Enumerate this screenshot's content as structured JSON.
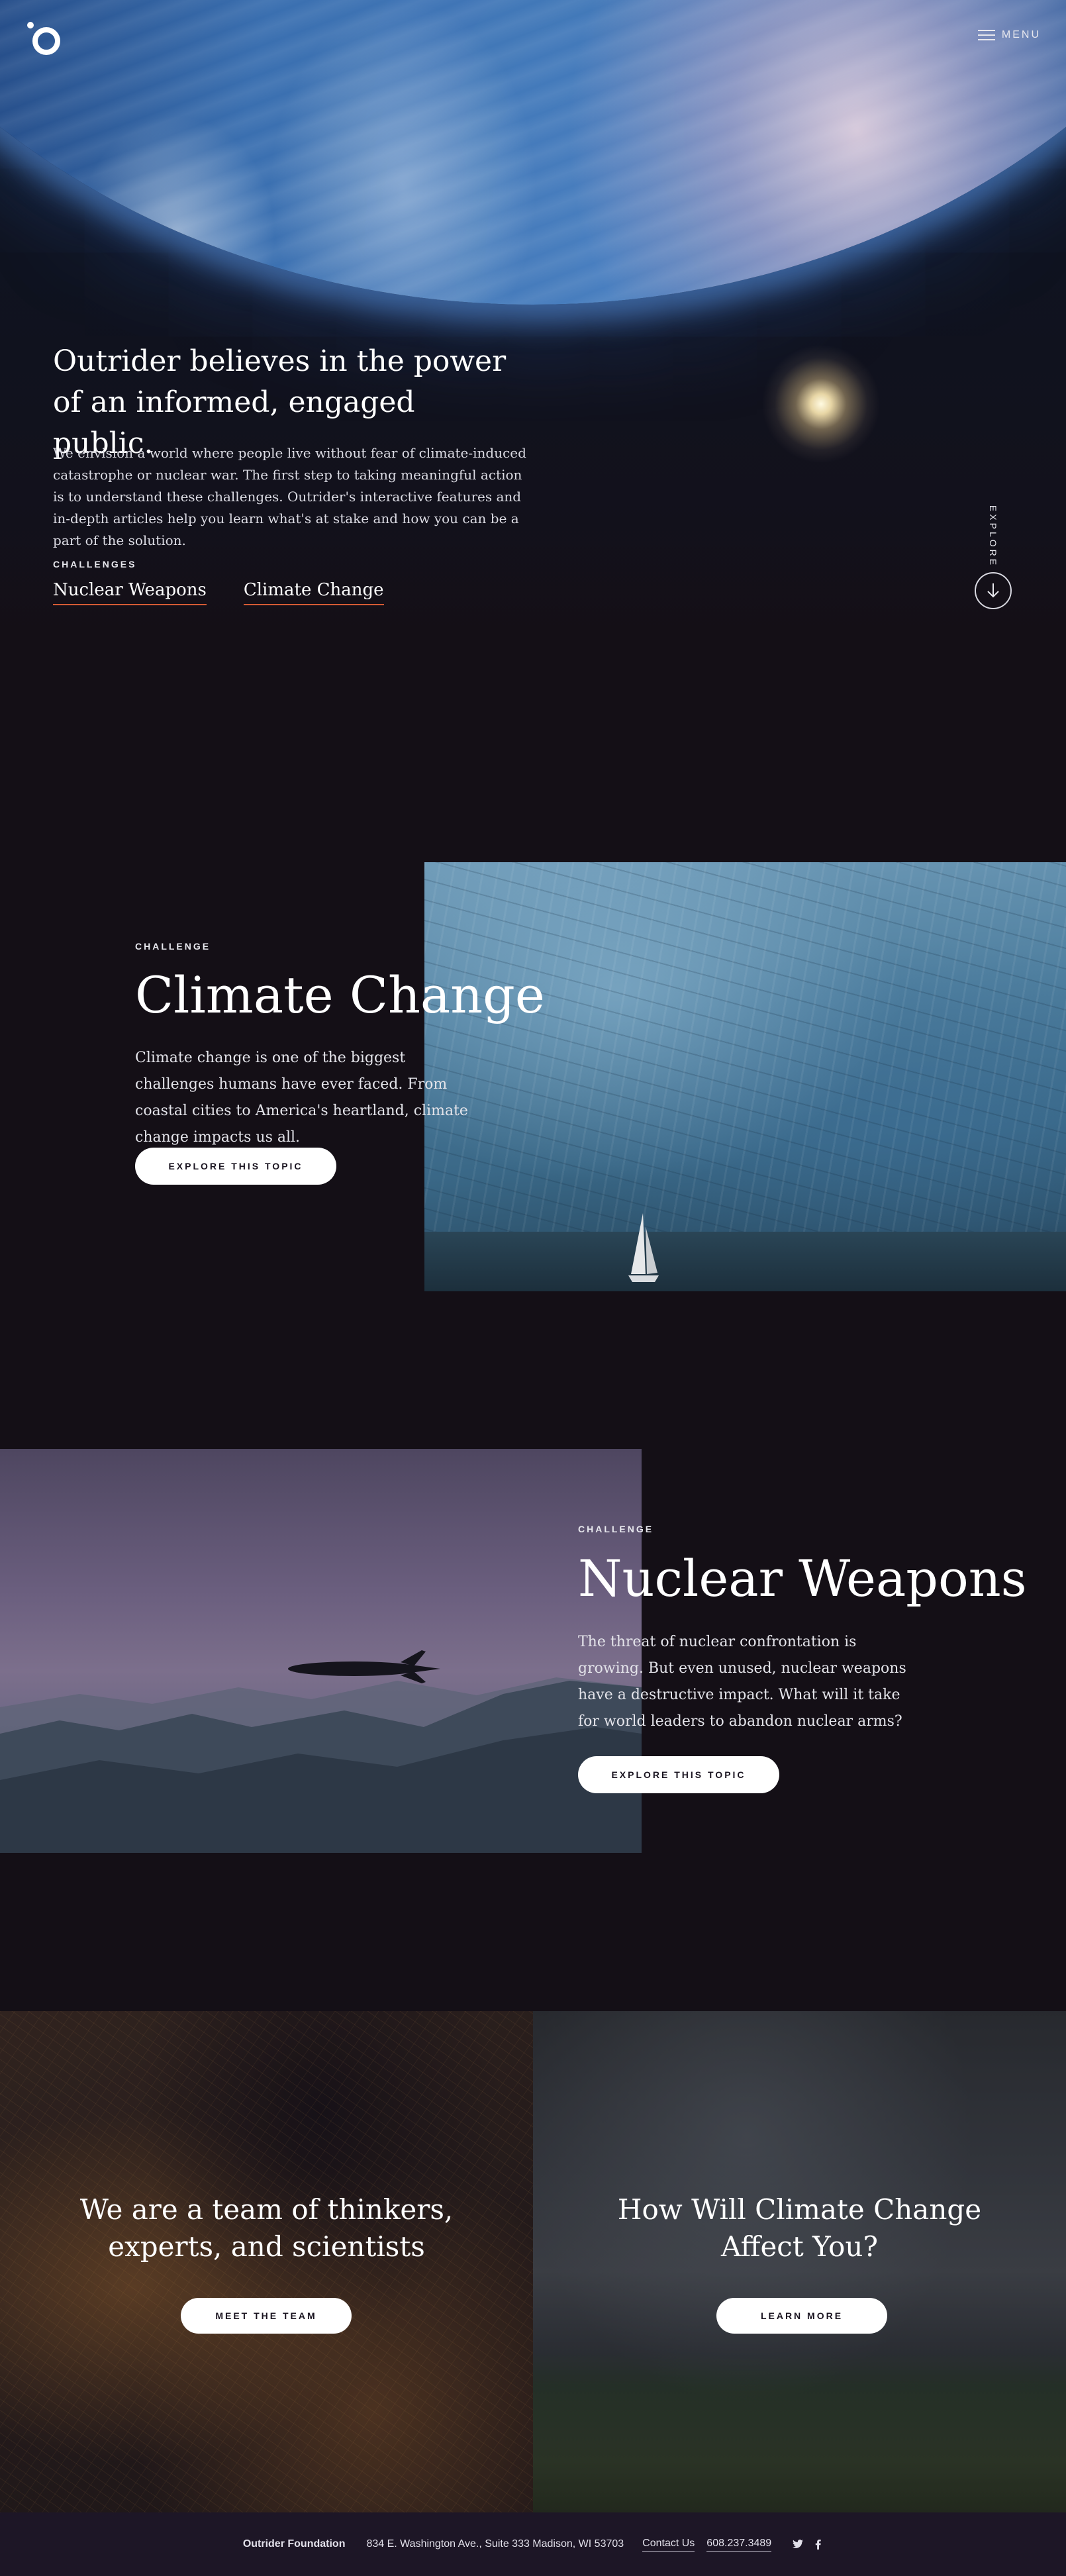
{
  "header": {
    "menu_label": "MENU"
  },
  "hero": {
    "title_line1": "Outrider believes in the power",
    "title_line2": "of an informed, engaged public.",
    "body": "We envision a world where people live without fear of climate-induced catastrophe or nuclear war. The first step to taking meaningful action is to understand these challenges. Outrider's interactive features and in-depth articles help you learn what's at stake and how you can be a part of the solution.",
    "challenges_label": "CHALLENGES",
    "links": [
      "Nuclear Weapons",
      "Climate Change"
    ],
    "explore_label": "EXPLORE",
    "link_underline_color": "#d45a34"
  },
  "climate": {
    "label": "CHALLENGE",
    "title": "Climate Change",
    "body": "Climate change is one of the biggest challenges humans have ever faced. From coastal cities to America's heartland, climate change impacts us all.",
    "button": "EXPLORE THIS TOPIC"
  },
  "nuclear": {
    "label": "CHALLENGE",
    "title": "Nuclear Weapons",
    "body": "The threat of nuclear confrontation is growing. But even unused, nuclear weapons have a destructive impact. What will it take for world leaders to abandon nuclear arms?",
    "button": "EXPLORE THIS TOPIC"
  },
  "tiles": {
    "team": {
      "title": "We are a team of thinkers, experts, and scientists",
      "button": "MEET THE TEAM"
    },
    "affect": {
      "title": "How Will Climate Change Affect You?",
      "button": "LEARN MORE"
    }
  },
  "footer": {
    "org": "Outrider Foundation",
    "address": "834 E. Washington Ave., Suite 333 Madison, WI 53703",
    "contact": "Contact Us",
    "phone": "608.237.3489",
    "social": [
      "twitter-icon",
      "facebook-icon"
    ]
  },
  "colors": {
    "background": "#140f16",
    "footer": "#1d1626",
    "button": "#ffffff",
    "accent": "#d45a34"
  }
}
